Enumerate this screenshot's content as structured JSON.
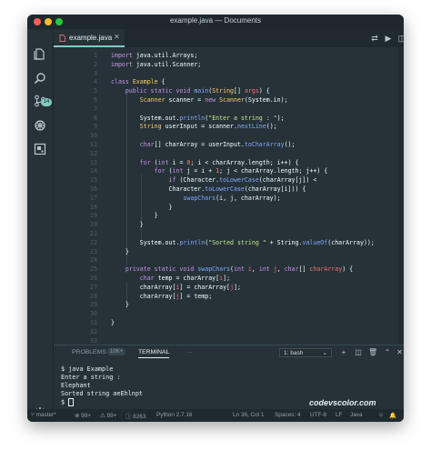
{
  "window": {
    "title": "example.java — Documents"
  },
  "activity": {
    "scm_badge": "14"
  },
  "tab": {
    "label": "example.java"
  },
  "editor": {
    "lines": [
      {
        "n": "1",
        "segs": [
          [
            "kw",
            "import "
          ],
          [
            "pl",
            "java.util.Arrays;"
          ]
        ]
      },
      {
        "n": "2",
        "segs": [
          [
            "kw",
            "import "
          ],
          [
            "pl",
            "java.util.Scanner;"
          ]
        ]
      },
      {
        "n": "3",
        "segs": []
      },
      {
        "n": "4",
        "segs": [
          [
            "kw",
            "class "
          ],
          [
            "ty",
            "Example "
          ],
          [
            "pl",
            "{"
          ]
        ]
      },
      {
        "n": "5",
        "segs": [
          [
            "pl",
            "    "
          ],
          [
            "kw",
            "public static void "
          ],
          [
            "fn",
            "main"
          ],
          [
            "pl",
            "("
          ],
          [
            "ty",
            "String"
          ],
          [
            "pl",
            "[] "
          ],
          [
            "pa",
            "args"
          ],
          [
            "pl",
            ") {"
          ]
        ]
      },
      {
        "n": "6",
        "segs": [
          [
            "pl",
            "        "
          ],
          [
            "ty",
            "Scanner "
          ],
          [
            "pl",
            "scanner = "
          ],
          [
            "kw",
            "new "
          ],
          [
            "ty",
            "Scanner"
          ],
          [
            "pl",
            "(System.in);"
          ]
        ]
      },
      {
        "n": "7",
        "segs": []
      },
      {
        "n": "8",
        "segs": [
          [
            "pl",
            "        System.out."
          ],
          [
            "fn",
            "println"
          ],
          [
            "pl",
            "("
          ],
          [
            "st",
            "\"Enter a string : \""
          ],
          [
            "pl",
            ");"
          ]
        ]
      },
      {
        "n": "9",
        "segs": [
          [
            "pl",
            "        "
          ],
          [
            "ty",
            "String "
          ],
          [
            "pl",
            "userInput = scanner."
          ],
          [
            "fn",
            "nextLine"
          ],
          [
            "pl",
            "();"
          ]
        ]
      },
      {
        "n": "10",
        "segs": []
      },
      {
        "n": "11",
        "segs": [
          [
            "pl",
            "        "
          ],
          [
            "kw",
            "char"
          ],
          [
            "pl",
            "[] charArray = userInput."
          ],
          [
            "fn",
            "toCharArray"
          ],
          [
            "pl",
            "();"
          ]
        ]
      },
      {
        "n": "12",
        "segs": []
      },
      {
        "n": "13",
        "segs": [
          [
            "pl",
            "        "
          ],
          [
            "kw",
            "for "
          ],
          [
            "pl",
            "("
          ],
          [
            "kw",
            "int "
          ],
          [
            "pl",
            "i = "
          ],
          [
            "nu",
            "0"
          ],
          [
            "pl",
            "; i < charArray.length; i++) {"
          ]
        ]
      },
      {
        "n": "14",
        "segs": [
          [
            "pl",
            "            "
          ],
          [
            "kw",
            "for "
          ],
          [
            "pl",
            "("
          ],
          [
            "kw",
            "int "
          ],
          [
            "pl",
            "j = i + "
          ],
          [
            "nu",
            "1"
          ],
          [
            "pl",
            "; j < charArray.length; j++) {"
          ]
        ]
      },
      {
        "n": "15",
        "segs": [
          [
            "pl",
            "                "
          ],
          [
            "kw",
            "if "
          ],
          [
            "pl",
            "(Character."
          ],
          [
            "fn",
            "toLowerCase"
          ],
          [
            "pl",
            "(charArray[j]) <"
          ]
        ]
      },
      {
        "n": "16",
        "segs": [
          [
            "pl",
            "                Character."
          ],
          [
            "fn",
            "toLowerCase"
          ],
          [
            "pl",
            "(charArray[i])) {"
          ]
        ]
      },
      {
        "n": "17",
        "segs": [
          [
            "pl",
            "                    "
          ],
          [
            "fn",
            "swapChars"
          ],
          [
            "pl",
            "(i, j, charArray);"
          ]
        ]
      },
      {
        "n": "18",
        "segs": [
          [
            "pl",
            "                }"
          ]
        ]
      },
      {
        "n": "19",
        "segs": [
          [
            "pl",
            "            }"
          ]
        ]
      },
      {
        "n": "20",
        "segs": [
          [
            "pl",
            "        }"
          ]
        ]
      },
      {
        "n": "21",
        "segs": []
      },
      {
        "n": "22",
        "segs": [
          [
            "pl",
            "        System.out."
          ],
          [
            "fn",
            "println"
          ],
          [
            "pl",
            "("
          ],
          [
            "st",
            "\"Sorted string \""
          ],
          [
            "pl",
            " + String."
          ],
          [
            "fn",
            "valueOf"
          ],
          [
            "pl",
            "(charArray));"
          ]
        ]
      },
      {
        "n": "23",
        "segs": [
          [
            "pl",
            "    }"
          ]
        ]
      },
      {
        "n": "24",
        "segs": []
      },
      {
        "n": "25",
        "segs": [
          [
            "pl",
            "    "
          ],
          [
            "kw",
            "private static void "
          ],
          [
            "fn",
            "swapChars"
          ],
          [
            "pl",
            "("
          ],
          [
            "kw",
            "int "
          ],
          [
            "pa",
            "i"
          ],
          [
            "pl",
            ", "
          ],
          [
            "kw",
            "int "
          ],
          [
            "pa",
            "j"
          ],
          [
            "pl",
            ", "
          ],
          [
            "kw",
            "char"
          ],
          [
            "pl",
            "[] "
          ],
          [
            "pa",
            "charArray"
          ],
          [
            "pl",
            ") {"
          ]
        ]
      },
      {
        "n": "26",
        "segs": [
          [
            "pl",
            "        "
          ],
          [
            "kw",
            "char "
          ],
          [
            "pl",
            "temp = charArray["
          ],
          [
            "pa",
            "i"
          ],
          [
            "pl",
            "];"
          ]
        ]
      },
      {
        "n": "27",
        "segs": [
          [
            "pl",
            "        charArray["
          ],
          [
            "pa",
            "i"
          ],
          [
            "pl",
            "] = charArray["
          ],
          [
            "pa",
            "j"
          ],
          [
            "pl",
            "];"
          ]
        ]
      },
      {
        "n": "28",
        "segs": [
          [
            "pl",
            "        charArray["
          ],
          [
            "pa",
            "j"
          ],
          [
            "pl",
            "] = temp;"
          ]
        ]
      },
      {
        "n": "29",
        "segs": [
          [
            "pl",
            "    }"
          ]
        ]
      },
      {
        "n": "30",
        "segs": []
      },
      {
        "n": "31",
        "segs": [
          [
            "pl",
            "}"
          ]
        ]
      },
      {
        "n": "32",
        "segs": []
      },
      {
        "n": "33",
        "segs": []
      }
    ]
  },
  "panel": {
    "problems_label": "PROBLEMS",
    "problems_count": "10K+",
    "terminal_label": "TERMINAL",
    "more": "···",
    "terminal_select": "1: bash",
    "terminal_lines": [
      "$ java Example",
      "Enter a string :",
      "Elephant",
      "Sorted string aeEhlnpt"
    ],
    "prompt": "$ "
  },
  "watermark": "codevscolor.com",
  "status": {
    "branch": "master*",
    "sync_a": "99+",
    "sync_b": "99+",
    "sync_c": "8263",
    "python": "Python 2.7.16",
    "position": "Ln 36, Col 1",
    "spaces": "Spaces: 4",
    "encoding": "UTF-8",
    "eol": "LF",
    "language": "Java"
  }
}
